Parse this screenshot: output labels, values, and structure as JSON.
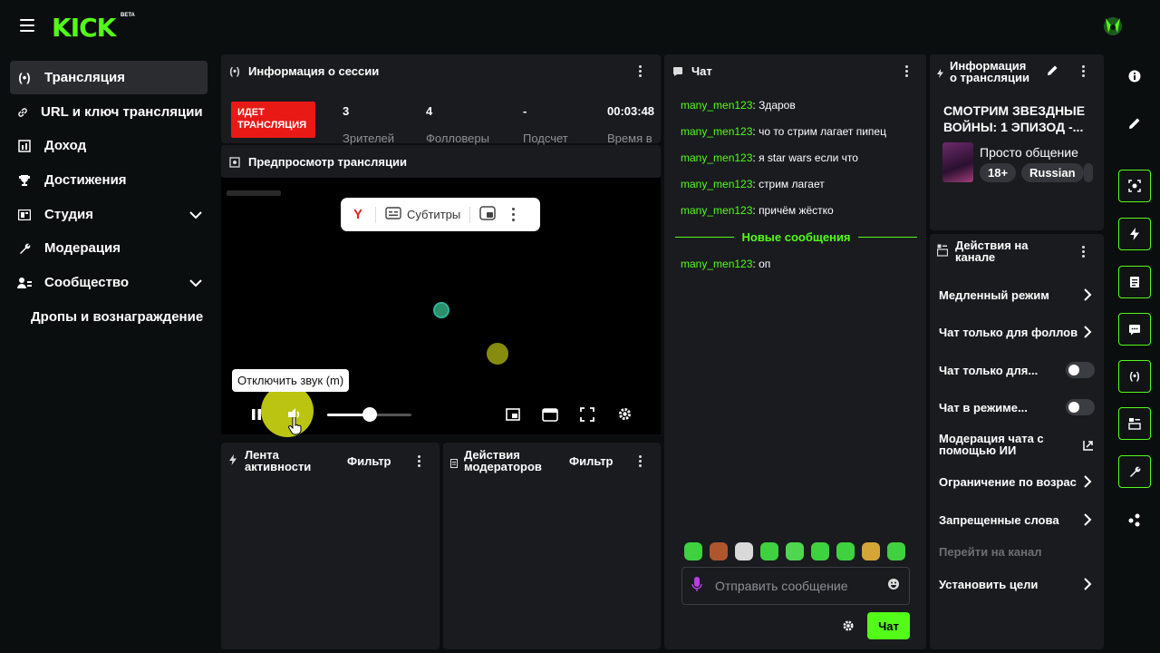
{
  "topbar": {
    "logo": "KICK",
    "beta": "BETA"
  },
  "sidebar": {
    "items": [
      {
        "label": "Трансляция",
        "icon": "broadcast-icon",
        "active": true
      },
      {
        "label": "URL и ключ трансляции",
        "icon": "link-icon"
      },
      {
        "label": "Доход",
        "icon": "chart-icon"
      },
      {
        "label": "Достижения",
        "icon": "trophy-icon"
      },
      {
        "label": "Студия",
        "icon": "studio-icon",
        "expandable": true
      },
      {
        "label": "Модерация",
        "icon": "wrench-icon"
      },
      {
        "label": "Сообщество",
        "icon": "community-icon",
        "expandable": true
      }
    ],
    "sub_item": "Дропы и вознаграждение"
  },
  "session": {
    "title": "Информация о сессии",
    "live_badge": "ИДЕТ ТРАНСЛЯЦИЯ",
    "stats": [
      {
        "value": "3",
        "label": "Зрителей"
      },
      {
        "value": "4",
        "label": "Фолловеры"
      },
      {
        "value": "-",
        "label": "Подсчет"
      },
      {
        "value": "00:03:48",
        "label": "Время в"
      }
    ]
  },
  "preview": {
    "title": "Предпросмотр трансляции",
    "subtitles_label": "Субтитры",
    "tooltip": "Отключить звук (m)",
    "volume": 0.5
  },
  "activity": {
    "title_line1": "Лента",
    "title_line2": "активности",
    "filter": "Фильтр"
  },
  "mod_actions": {
    "title_line1": "Действия",
    "title_line2": "модераторов",
    "filter": "Фильтр"
  },
  "chat": {
    "title": "Чат",
    "messages": [
      {
        "user": "many_men123",
        "text": "Здаров"
      },
      {
        "user": "many_men123",
        "text": "чо то стрим лагает пипец"
      },
      {
        "user": "many_men123",
        "text": "я star wars если что"
      },
      {
        "user": "many_men123",
        "text": "стрим лагает"
      },
      {
        "user": "many_men123",
        "text": "причём жёстко"
      }
    ],
    "new_messages_label": "Новые сообщения",
    "new_messages": [
      {
        "user": "many_men123",
        "text": "оп"
      }
    ],
    "input_placeholder": "Отправить сообщение",
    "send_label": "Чат",
    "emote_colors": [
      "#3fd13f",
      "#b0562f",
      "#d9d9d9",
      "#3fd13f",
      "#4fd64f",
      "#3fd13f",
      "#3fd13f",
      "#d4a637",
      "#3fd13f"
    ]
  },
  "stream_info": {
    "title_line1": "Информация",
    "title_line2": "о трансляции",
    "stream_title": "СМОТРИМ ЗВЕЗДНЫЕ ВОЙНЫ: 1 ЭПИЗОД -...",
    "category": "Просто общение",
    "tags": [
      "18+",
      "Russian"
    ]
  },
  "channel_actions": {
    "title_line1": "Действия на",
    "title_line2": "канале",
    "items": [
      {
        "label": "Медленный режим",
        "control": "chevron"
      },
      {
        "label": "Чат только для фоллов",
        "control": "chevron"
      },
      {
        "label": "Чат только для...",
        "control": "toggle",
        "on": false
      },
      {
        "label": "Чат в режиме...",
        "control": "toggle",
        "on": false
      },
      {
        "label_line1": "Модерация чата с",
        "label_line2": "помощью ИИ",
        "control": "external"
      },
      {
        "label": "Ограничение по возрас",
        "control": "chevron"
      },
      {
        "label": "Запрещенные слова",
        "control": "chevron"
      },
      {
        "label": "Перейти на канал",
        "control": "none",
        "disabled": true
      },
      {
        "label": "Установить цели",
        "control": "chevron"
      }
    ]
  },
  "rail": {
    "buttons": [
      "info-icon",
      "pencil-icon",
      "camera-icon",
      "bolt-icon",
      "notes-icon",
      "chat-icon",
      "broadcast-icon",
      "layout-icon",
      "wrench-icon",
      "dots-icon"
    ]
  },
  "colors": {
    "accent": "#53fc18",
    "live": "#e91916",
    "panel": "#191b1f",
    "bg": "#0b0e0f"
  }
}
